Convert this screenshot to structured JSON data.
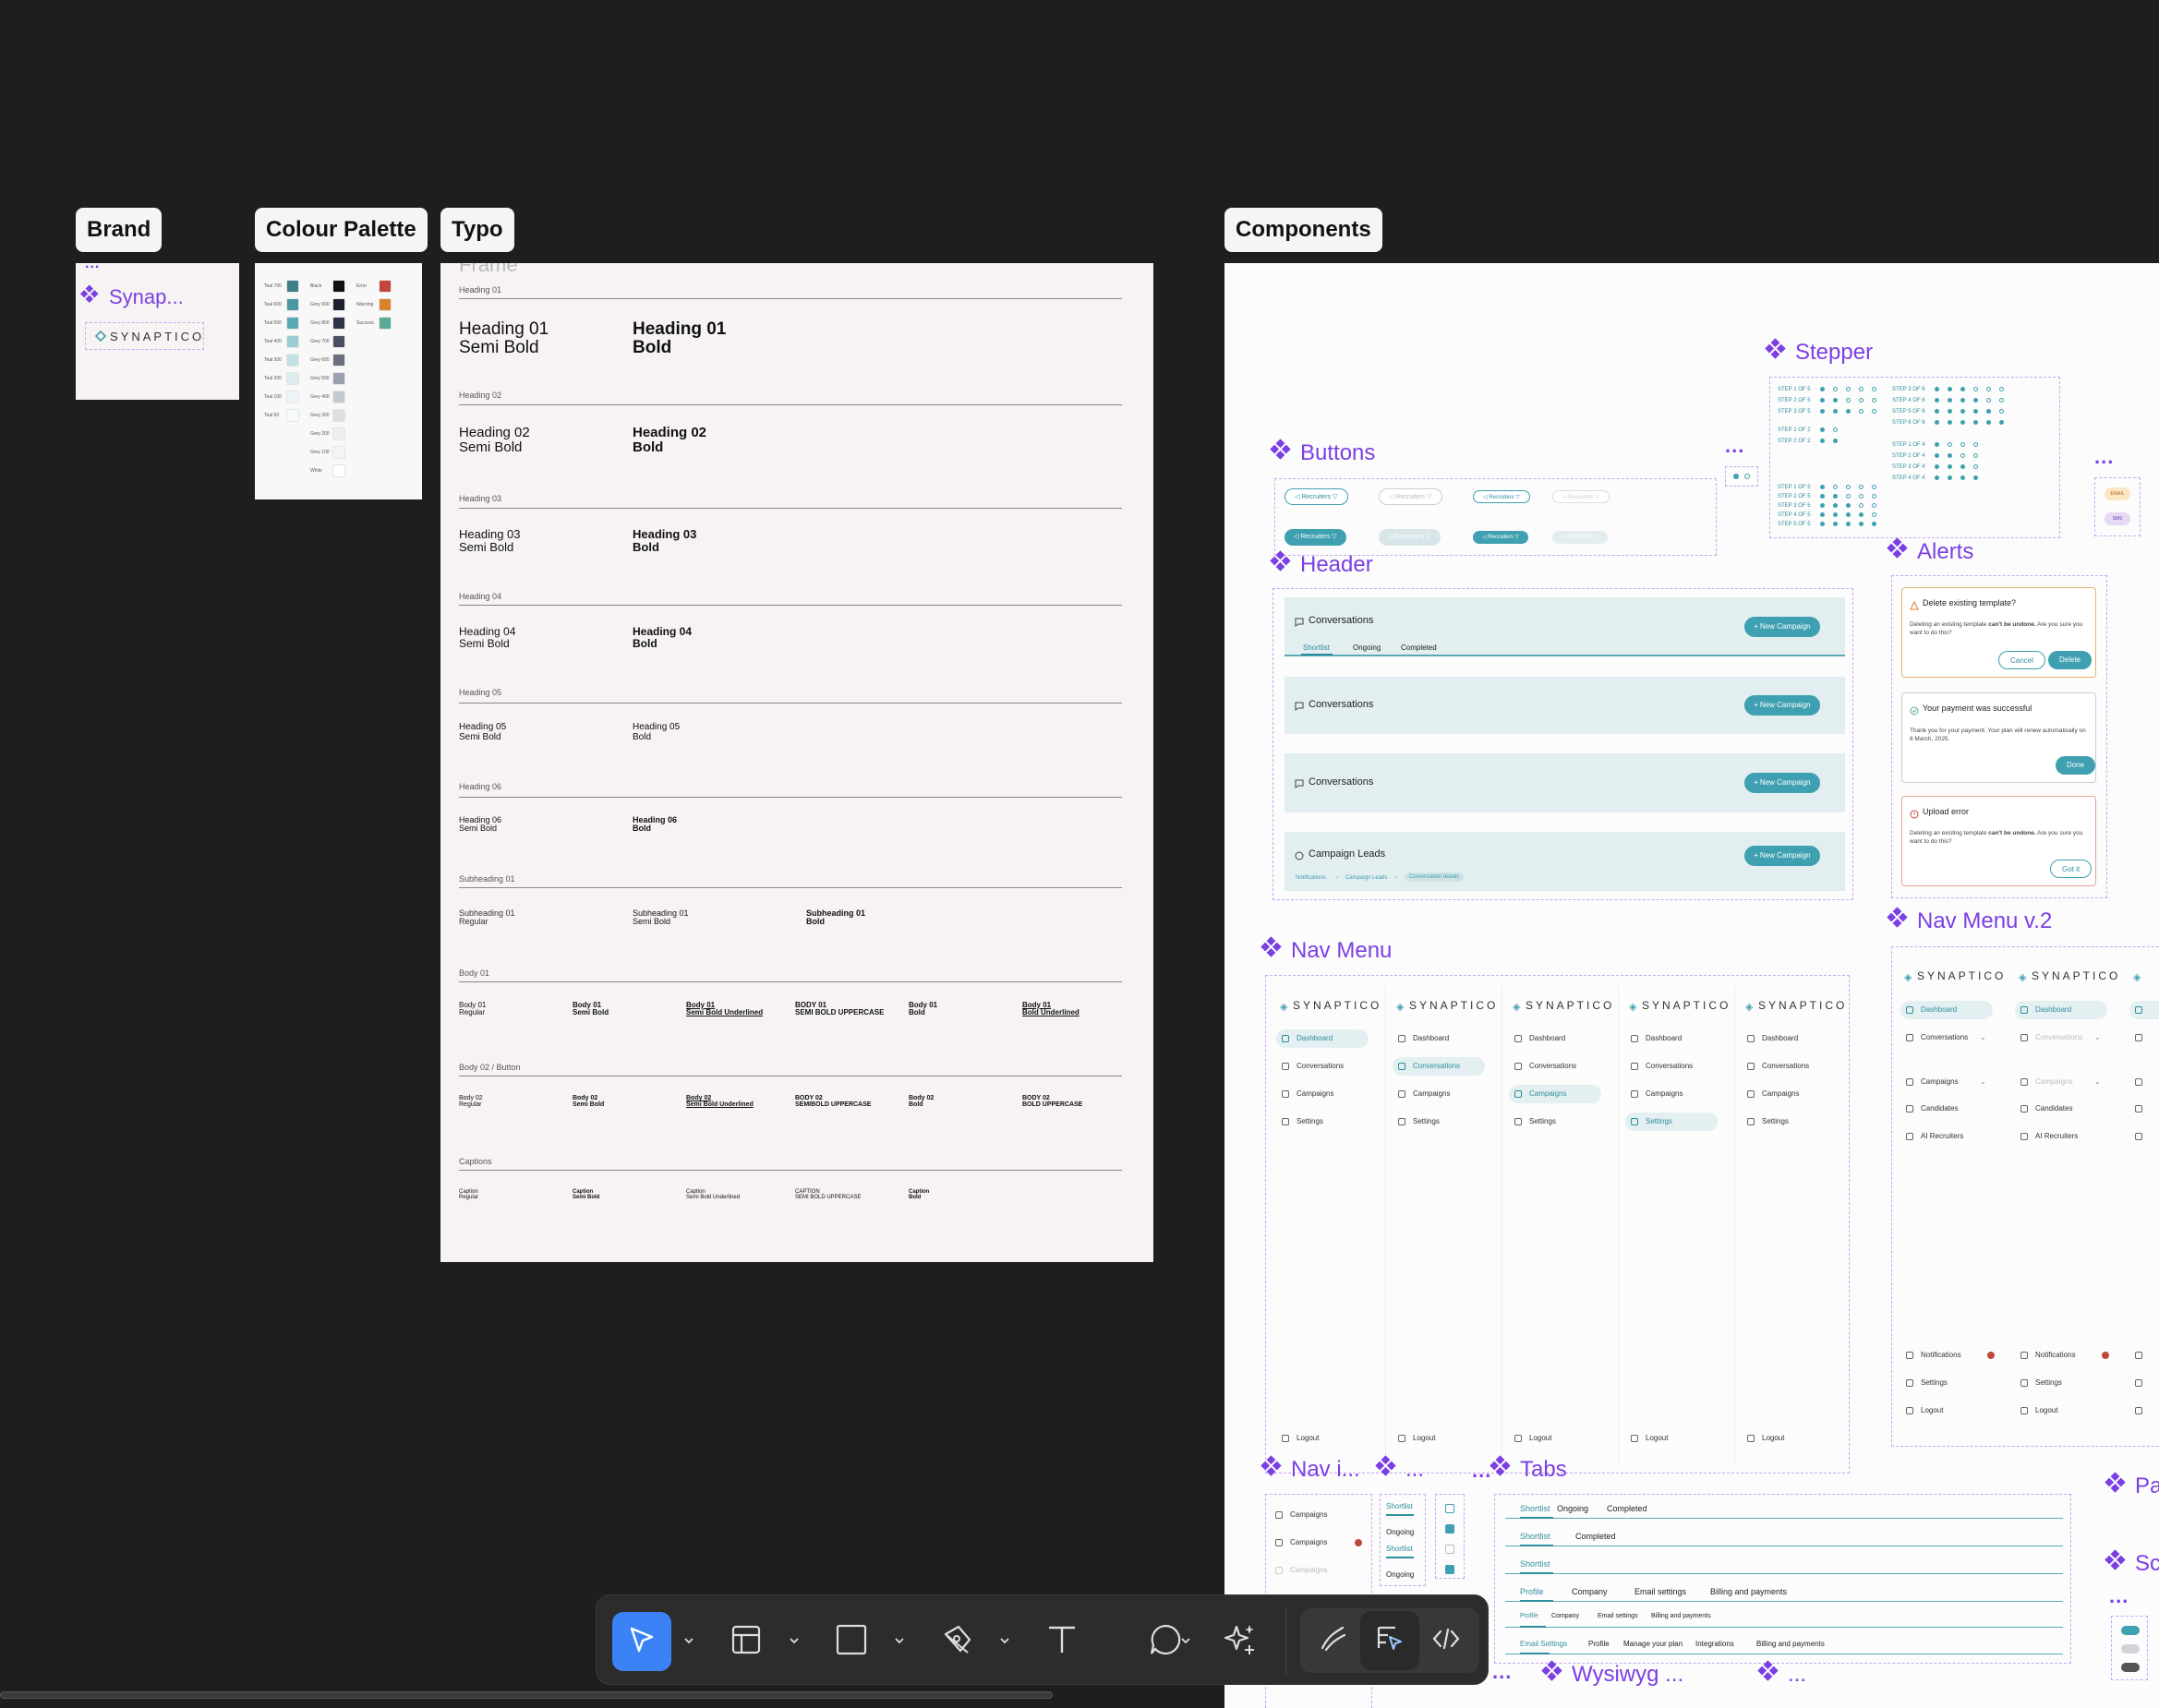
{
  "frames": {
    "brand": "Brand",
    "colour_palette": "Colour Palette",
    "typo": "Typo",
    "components": "Components"
  },
  "brand": {
    "component_name": "Synap...",
    "logo_text": "SYNAPTICO"
  },
  "typo": {
    "frame_name": "Frame",
    "heading01": {
      "section": "Heading 01",
      "semi": "Heading 01\nSemi Bold",
      "bold": "Heading 01\nBold"
    },
    "heading02": {
      "section": "Heading 02",
      "semi": "Heading 02\nSemi Bold",
      "bold": "Heading 02\nBold"
    },
    "heading03": {
      "section": "Heading 03",
      "semi": "Heading 03\nSemi Bold",
      "bold": "Heading 03\nBold"
    },
    "heading04": {
      "section": "Heading 04",
      "semi": "Heading 04\nSemi Bold",
      "bold": "Heading 04\nBold"
    },
    "heading05": {
      "section": "Heading 05",
      "semi": "Heading 05\nSemi Bold",
      "bold": "Heading 05\nBold"
    },
    "heading06": {
      "section": "Heading 06",
      "semi": "Heading 06\nSemi Bold",
      "bold": "Heading 06\nBold"
    },
    "subheading01": {
      "section": "Subheading 01",
      "regular": "Subheading 01\nRegular",
      "semi": "Subheading 01\nSemi Bold",
      "bold": "Subheading 01\nBold"
    },
    "body01": {
      "section": "Body 01",
      "items": [
        "Body 01\nRegular",
        "Body 01\nSemi Bold",
        "Body 01\nSemi Bold Underlined",
        "BODY 01\nSEMI BOLD UPPERCASE",
        "Body 01\nBold",
        "Body 01\nBold Underlined"
      ]
    },
    "body02": {
      "section": "Body 02 / Button",
      "items": [
        "Body 02\nRegular",
        "Body 02\nSemi Bold",
        "Body 02\nSemi Bold Underlined",
        "BODY 02\nSEMIBOLD UPPERCASE",
        "Body 02\nBold",
        "BODY 02\nBOLD UPPERCASE"
      ]
    },
    "captions": {
      "section": "Captions",
      "items": [
        "Caption\nRegular",
        "Caption\nSemi Bold",
        "Caption\nSemi Bold Underlined",
        "CAPTION\nSEMI BOLD UPPERCASE",
        "Caption\nBold"
      ]
    }
  },
  "palette": {
    "col1": [
      {
        "label": "Teal 700",
        "color": "#3f7f88"
      },
      {
        "label": "Teal 600",
        "color": "#4a98a3"
      },
      {
        "label": "Teal 500",
        "color": "#5aaab5"
      },
      {
        "label": "Teal 400",
        "color": "#9ccdd4"
      },
      {
        "label": "Teal 300",
        "color": "#c3e1e5"
      },
      {
        "label": "Teal 200",
        "color": "#dcedf0"
      },
      {
        "label": "Teal 100",
        "color": "#ebf4f6"
      },
      {
        "label": "Teal 50",
        "color": "#f5fafb"
      }
    ],
    "col2": [
      {
        "label": "Black",
        "color": "#111111"
      },
      {
        "label": "Grey 900",
        "color": "#1e2230"
      },
      {
        "label": "Grey 800",
        "color": "#2e3345"
      },
      {
        "label": "Grey 700",
        "color": "#4a4f60"
      },
      {
        "label": "Grey 600",
        "color": "#6b7080"
      },
      {
        "label": "Grey 500",
        "color": "#9aa0ad"
      },
      {
        "label": "Grey 400",
        "color": "#c4c8d0"
      },
      {
        "label": "Grey 300",
        "color": "#dcdfe4"
      },
      {
        "label": "Grey 200",
        "color": "#eceef1"
      },
      {
        "label": "Grey 100",
        "color": "#f4f5f7"
      },
      {
        "label": "White",
        "color": "#ffffff"
      }
    ],
    "col3": [
      {
        "label": "Error",
        "color": "#c0473a"
      },
      {
        "label": "Warning",
        "color": "#d9822b"
      },
      {
        "label": "Success",
        "color": "#5aaa96"
      }
    ]
  },
  "components": {
    "stepper": "Stepper",
    "buttons": "Buttons",
    "header": "Header",
    "alerts": "Alerts",
    "nav_menu": "Nav Menu",
    "nav_menu_v2": "Nav Menu v.2",
    "nav_item": "Nav i...",
    "tabs": "Tabs",
    "wysiwyg": "Wysiwyg ...",
    "pa": "Pa",
    "sc": "Sc",
    "dots": "...",
    "dots_diamond": "...",
    "button_label": "Recruiters",
    "badge_email": "EMAIL",
    "badge_sms": "SMS",
    "header_rows": [
      {
        "title": "Conversations",
        "button": "+ New Campaign",
        "tabs": [
          "Shortlist",
          "Ongoing",
          "Completed"
        ]
      },
      {
        "title": "Conversations",
        "button": "+ New Campaign"
      },
      {
        "title": "Conversations",
        "button": "+ New Campaign"
      },
      {
        "title": "Campaign Leads",
        "button": "+ New Campaign",
        "breadcrumbs": [
          "Notifications",
          "Campaign Leads",
          "Conversation details"
        ]
      }
    ],
    "alert_items": [
      {
        "title": "Delete existing template?",
        "body_pre": "Deleting an existing template ",
        "body_bold": "can't be undone.",
        "body_post": " Are you sure you want to do this?",
        "cancel": "Cancel",
        "confirm": "Delete"
      },
      {
        "title": "Your payment was successful",
        "body": "Thank you for your payment. Your plan will renew automatically on 8 March, 2025.",
        "confirm": "Done"
      },
      {
        "title": "Upload error",
        "body_pre": "Deleting an existing template ",
        "body_bold": "can't be undone.",
        "body_post": " Are you sure you want to do this?",
        "confirm": "Got it"
      }
    ],
    "nav": {
      "logo": "SYNAPTICO",
      "items": [
        "Dashboard",
        "Conversations",
        "Campaigns",
        "Settings"
      ],
      "logout": "Logout"
    },
    "nav_v2": {
      "logo": "SYNAPTICO",
      "items": [
        "Dashboard",
        "Conversations",
        "Campaigns",
        "Candidates",
        "AI Recruiters"
      ],
      "bottom": [
        "Notifications",
        "Settings",
        "Logout"
      ]
    },
    "nav_items_list": [
      "Campaigns",
      "Campaigns",
      "Campaigns"
    ],
    "tab_small": [
      "Shortlist",
      "Ongoing",
      "Shortlist",
      "Ongoing"
    ],
    "tab_rows": [
      [
        "Shortlist",
        "Ongoing",
        "Completed"
      ],
      [
        "Shortlist",
        "Completed"
      ],
      [
        "Shortlist"
      ],
      [
        "Profile",
        "Company",
        "Email settings",
        "Billing and payments"
      ],
      [
        "Profile",
        "Company",
        "Email settings",
        "Billing and payments"
      ],
      [
        "Email Settings",
        "Profile",
        "Manage your plan",
        "Integrations",
        "Billing and payments"
      ]
    ],
    "stepper_left": [
      "STEP 1 OF 5",
      "STEP 2 OF 5",
      "STEP 3 OF 5",
      "STEP 1 OF 2",
      "STEP 2 OF 2"
    ],
    "stepper_right": [
      "STEP 3 OF 6",
      "STEP 4 OF 6",
      "STEP 5 OF 6",
      "STEP 6 OF 6",
      "STEP 1 OF 4",
      "STEP 2 OF 4",
      "STEP 3 OF 4",
      "STEP 4 OF 4"
    ],
    "stepper_bottom": [
      "STEP 1 OF 5",
      "STEP 2 OF 5",
      "STEP 3 OF 5",
      "STEP 4 OF 5",
      "STEP 5 OF 5"
    ]
  },
  "colors": {
    "canvas": "#1e1e1e",
    "accent": "#7b3fe4",
    "teal": "#3ea0b0",
    "toolbar_active": "#3b82f6"
  },
  "toolbar": {
    "tools": [
      "move-icon",
      "frame-icon",
      "rectangle-icon",
      "pen-icon",
      "text-icon",
      "comment-icon",
      "ai-sparkle-icon"
    ],
    "modes": [
      "draw-mode-icon",
      "design-mode-icon",
      "dev-mode-icon"
    ]
  }
}
